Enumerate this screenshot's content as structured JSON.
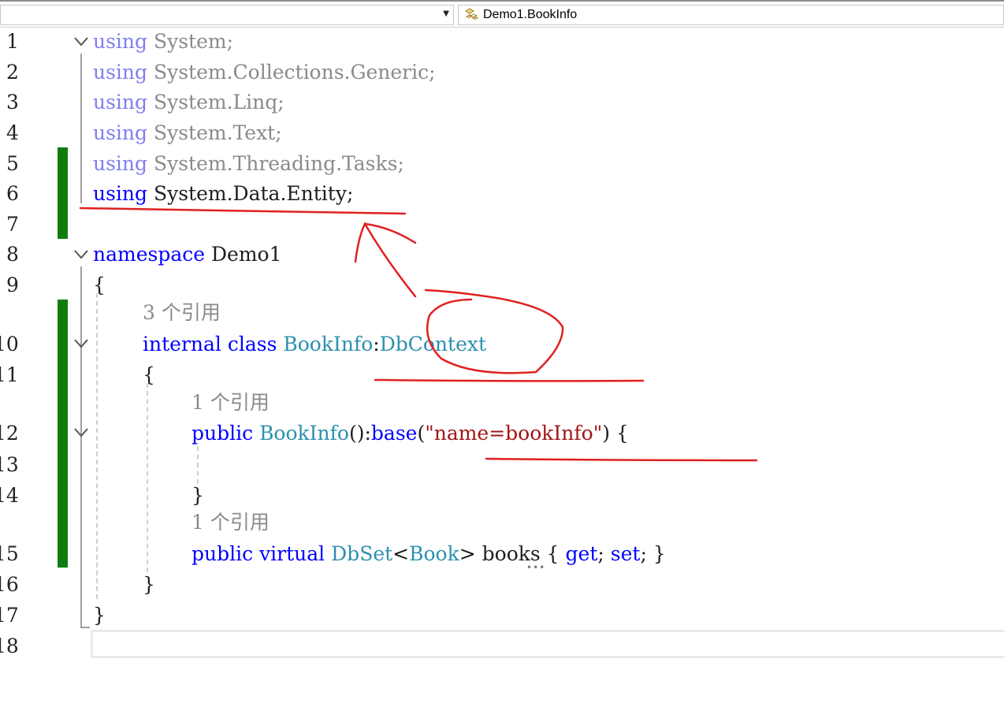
{
  "navbar": {
    "left_dropdown_value": "",
    "right_dropdown_value": "Demo1.BookInfo",
    "right_dropdown_icon": "class-icon"
  },
  "colors": {
    "keyword": "#0000ff",
    "type": "#2b91af",
    "string": "#a31515",
    "change_marker": "#107c10",
    "annotation": "#e02020"
  },
  "line_numbers": [
    "1",
    "2",
    "3",
    "4",
    "5",
    "6",
    "7",
    "8",
    "9",
    "10",
    "11",
    "12",
    "13",
    "14",
    "15",
    "16",
    "17",
    "18"
  ],
  "code": {
    "l1_kw": "using",
    "l1_rest": " System;",
    "l2_kw": "using",
    "l2_rest": " System.Collections.Generic;",
    "l3_kw": "using",
    "l3_rest": " System.Linq;",
    "l4_kw": "using",
    "l4_rest": " System.Text;",
    "l5_kw": "using",
    "l5_rest": " System.Threading.Tasks;",
    "l6_kw": "using",
    "l6_rest": " System.Data.Entity;",
    "l8_kw": "namespace",
    "l8_rest": " Demo1",
    "l9": "{",
    "lens_class": "3 个引用",
    "l10_kw1": "internal",
    "l10_kw2": "class",
    "l10_type1": "BookInfo",
    "l10_colon": ":",
    "l10_type2": "DbContext",
    "l11": "{",
    "lens_ctor": "1 个引用",
    "l12_kw": "public",
    "l12_type": "BookInfo",
    "l12_mid": "():",
    "l12_base": "base",
    "l12_paren": "(",
    "l12_str": "\"name=bookInfo\"",
    "l12_end": ") {",
    "l14": "}",
    "lens_prop": "1 个引用",
    "l15_kw1": "public",
    "l15_kw2": "virtual",
    "l15_type1": "DbSet",
    "l15_lt": "<",
    "l15_type2": "Book",
    "l15_gt": ">",
    "l15_name": " books { ",
    "l15_get": "get",
    "l15_semi1": "; ",
    "l15_set": "set",
    "l15_semi2": "; }",
    "l16": "}",
    "l17": "}"
  }
}
